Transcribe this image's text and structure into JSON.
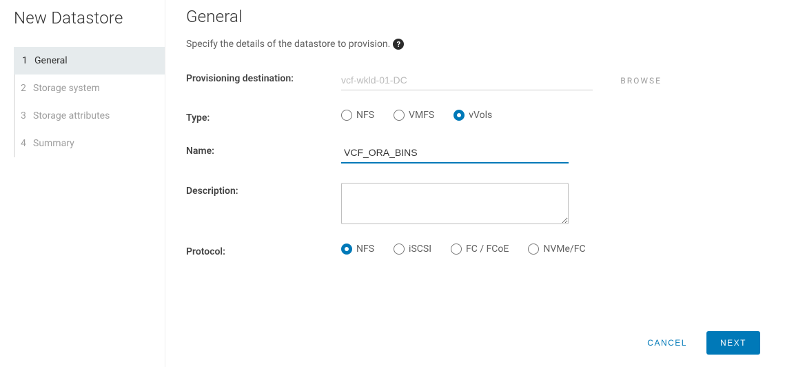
{
  "wizard": {
    "title": "New Datastore",
    "steps": [
      {
        "num": "1",
        "label": "General",
        "active": true
      },
      {
        "num": "2",
        "label": "Storage system",
        "active": false
      },
      {
        "num": "3",
        "label": "Storage attributes",
        "active": false
      },
      {
        "num": "4",
        "label": "Summary",
        "active": false
      }
    ]
  },
  "page": {
    "title": "General",
    "subtitle": "Specify the details of the datastore to provision."
  },
  "form": {
    "destination_label": "Provisioning destination:",
    "destination_value": "vcf-wkld-01-DC",
    "browse_label": "BROWSE",
    "type_label": "Type:",
    "type_options": {
      "nfs": "NFS",
      "vmfs": "VMFS",
      "vvols": "vVols"
    },
    "type_selected": "vvols",
    "name_label": "Name:",
    "name_value": "VCF_ORA_BINS",
    "description_label": "Description:",
    "description_value": "",
    "protocol_label": "Protocol:",
    "protocol_options": {
      "nfs": "NFS",
      "iscsi": "iSCSI",
      "fcfcoe": "FC / FCoE",
      "nvmefc": "NVMe/FC"
    },
    "protocol_selected": "nfs"
  },
  "footer": {
    "cancel": "CANCEL",
    "next": "NEXT"
  }
}
